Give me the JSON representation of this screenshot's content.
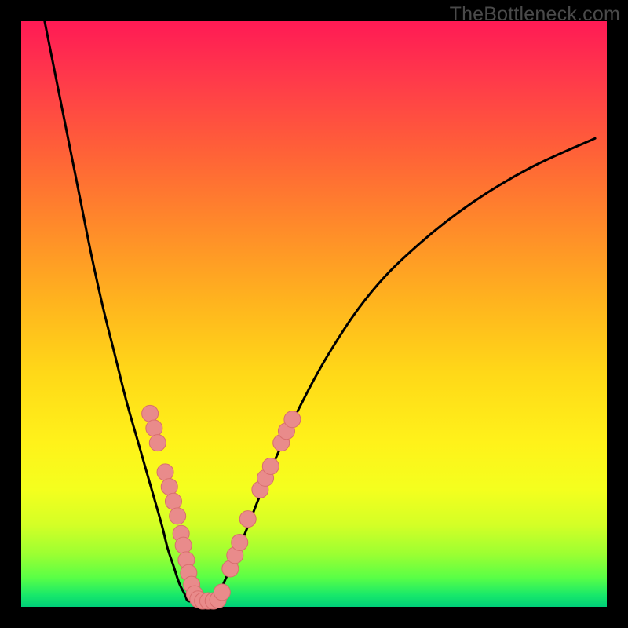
{
  "watermark": "TheBottleneck.com",
  "colors": {
    "frame": "#000000",
    "curve": "#000000",
    "marker_fill": "#e98b8b",
    "marker_stroke": "#d86e6e"
  },
  "chart_data": {
    "type": "line",
    "title": "",
    "xlabel": "",
    "ylabel": "",
    "xlim": [
      0,
      100
    ],
    "ylim": [
      0,
      100
    ],
    "grid": false,
    "legend": false,
    "note": "Axes are unlabeled; values are pixel-normalized 0–100 estimates read from the image (origin bottom-left).",
    "series": [
      {
        "name": "curve-left",
        "x": [
          4,
          6,
          8,
          10,
          12,
          14,
          16,
          18,
          20,
          22,
          24,
          25,
          26,
          27,
          28,
          28.5
        ],
        "y": [
          100,
          90,
          80,
          70,
          60,
          51,
          43,
          35,
          28,
          21,
          14,
          10,
          7,
          4,
          2,
          1
        ]
      },
      {
        "name": "curve-flat",
        "x": [
          28.5,
          30,
          31.5,
          33
        ],
        "y": [
          1,
          1,
          1,
          1
        ]
      },
      {
        "name": "curve-right",
        "x": [
          33,
          35,
          38,
          42,
          47,
          53,
          60,
          68,
          77,
          87,
          98
        ],
        "y": [
          1,
          5,
          12,
          22,
          33,
          44,
          54,
          62,
          69,
          75,
          80
        ]
      }
    ],
    "markers": {
      "name": "highlighted-points",
      "points": [
        {
          "x": 22.0,
          "y": 33.0
        },
        {
          "x": 22.7,
          "y": 30.5
        },
        {
          "x": 23.3,
          "y": 28.0
        },
        {
          "x": 24.6,
          "y": 23.0
        },
        {
          "x": 25.3,
          "y": 20.5
        },
        {
          "x": 26.0,
          "y": 18.0
        },
        {
          "x": 26.7,
          "y": 15.5
        },
        {
          "x": 27.3,
          "y": 12.5
        },
        {
          "x": 27.7,
          "y": 10.5
        },
        {
          "x": 28.2,
          "y": 8.0
        },
        {
          "x": 28.6,
          "y": 5.8
        },
        {
          "x": 29.1,
          "y": 3.8
        },
        {
          "x": 29.6,
          "y": 2.2
        },
        {
          "x": 30.2,
          "y": 1.3
        },
        {
          "x": 31.0,
          "y": 1.0
        },
        {
          "x": 31.9,
          "y": 1.0
        },
        {
          "x": 32.8,
          "y": 1.0
        },
        {
          "x": 33.6,
          "y": 1.2
        },
        {
          "x": 34.3,
          "y": 2.5
        },
        {
          "x": 35.7,
          "y": 6.5
        },
        {
          "x": 36.5,
          "y": 8.8
        },
        {
          "x": 37.3,
          "y": 11.0
        },
        {
          "x": 38.7,
          "y": 15.0
        },
        {
          "x": 40.8,
          "y": 20.0
        },
        {
          "x": 41.7,
          "y": 22.0
        },
        {
          "x": 42.6,
          "y": 24.0
        },
        {
          "x": 44.4,
          "y": 28.0
        },
        {
          "x": 45.3,
          "y": 30.0
        },
        {
          "x": 46.3,
          "y": 32.0
        }
      ]
    }
  }
}
